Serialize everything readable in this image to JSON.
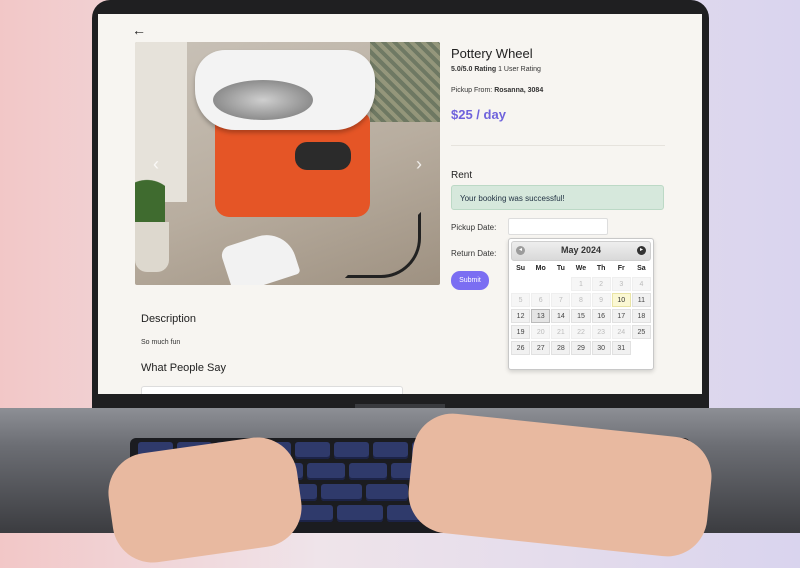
{
  "product": {
    "title": "Pottery Wheel",
    "rating_value": "5.0/5.0 Rating",
    "rating_count": "1 User Rating",
    "pickup_label": "Pickup From:",
    "pickup_location": "Rosanna, 3084",
    "price": "$25 / day"
  },
  "nav": {
    "back_icon": "arrow-left-icon",
    "back_glyph": "←"
  },
  "gallery": {
    "prev_glyph": "‹",
    "next_glyph": "›"
  },
  "rent": {
    "heading": "Rent",
    "success_message": "Your booking was successful!",
    "pickup_date_label": "Pickup Date:",
    "return_date_label": "Return Date:",
    "submit_label": "Submit"
  },
  "description": {
    "heading": "Description",
    "text": "So much fun"
  },
  "reviews": {
    "heading": "What People Say"
  },
  "datepicker": {
    "month_title": "May 2024",
    "weekdays": [
      "Su",
      "Mo",
      "Tu",
      "We",
      "Th",
      "Fr",
      "Sa"
    ],
    "days": [
      {
        "d": "",
        "s": "blank"
      },
      {
        "d": "",
        "s": "blank"
      },
      {
        "d": "",
        "s": "blank"
      },
      {
        "d": "1",
        "s": "disabled"
      },
      {
        "d": "2",
        "s": "disabled"
      },
      {
        "d": "3",
        "s": "disabled"
      },
      {
        "d": "4",
        "s": "disabled"
      },
      {
        "d": "5",
        "s": "disabled"
      },
      {
        "d": "6",
        "s": "disabled"
      },
      {
        "d": "7",
        "s": "disabled"
      },
      {
        "d": "8",
        "s": "disabled"
      },
      {
        "d": "9",
        "s": "disabled"
      },
      {
        "d": "10",
        "s": "today"
      },
      {
        "d": "11",
        "s": ""
      },
      {
        "d": "12",
        "s": ""
      },
      {
        "d": "13",
        "s": "active"
      },
      {
        "d": "14",
        "s": ""
      },
      {
        "d": "15",
        "s": ""
      },
      {
        "d": "16",
        "s": ""
      },
      {
        "d": "17",
        "s": ""
      },
      {
        "d": "18",
        "s": ""
      },
      {
        "d": "19",
        "s": ""
      },
      {
        "d": "20",
        "s": "disabled"
      },
      {
        "d": "21",
        "s": "disabled"
      },
      {
        "d": "22",
        "s": "disabled"
      },
      {
        "d": "23",
        "s": "disabled"
      },
      {
        "d": "24",
        "s": "disabled"
      },
      {
        "d": "25",
        "s": ""
      },
      {
        "d": "26",
        "s": ""
      },
      {
        "d": "27",
        "s": ""
      },
      {
        "d": "28",
        "s": ""
      },
      {
        "d": "29",
        "s": ""
      },
      {
        "d": "30",
        "s": ""
      },
      {
        "d": "31",
        "s": ""
      }
    ]
  },
  "colors": {
    "accent": "#7b6ef2",
    "price": "#6f63dc",
    "success_bg": "#d6e8dc",
    "product_orange": "#e55526"
  }
}
